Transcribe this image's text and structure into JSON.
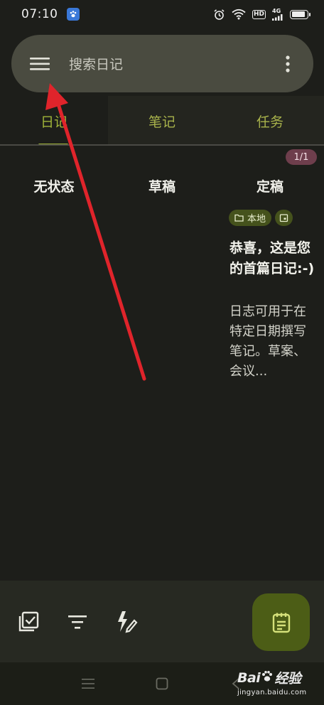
{
  "status_bar": {
    "time": "07:10",
    "hd": "HD",
    "network": "4G",
    "battery_level": 0.9
  },
  "search": {
    "placeholder": "搜索日记"
  },
  "tabs": [
    {
      "label": "日记",
      "active": true
    },
    {
      "label": "笔记",
      "active": false
    },
    {
      "label": "任务",
      "active": false
    }
  ],
  "page_indicator": "1/1",
  "columns": [
    "无状态",
    "草稿",
    "定稿"
  ],
  "card": {
    "chip_location": "本地",
    "title": "恭喜，这是您的首篇日记:-)",
    "body": "日志可用于在特定日期撰写笔记。草案、会议..."
  },
  "icons": {
    "menu": "hamburger-menu-icon",
    "more": "vertical-dots-icon",
    "folder": "folder-icon",
    "calendar": "calendar-icon",
    "select_all": "checklist-icon",
    "filter": "filter-icon",
    "quick_edit": "flash-edit-icon",
    "new_journal": "notepad-icon"
  },
  "watermark": {
    "brand": "Bai",
    "brand_suffix": "经验",
    "url": "jingyan.baidu.com"
  },
  "colors": {
    "background": "#1d1e1a",
    "search_bar": "#4a4b40",
    "accent": "#9fb339",
    "fab": "#4c5d16",
    "page_badge": "#6e3e4c",
    "annotation_arrow": "#e0242b"
  }
}
